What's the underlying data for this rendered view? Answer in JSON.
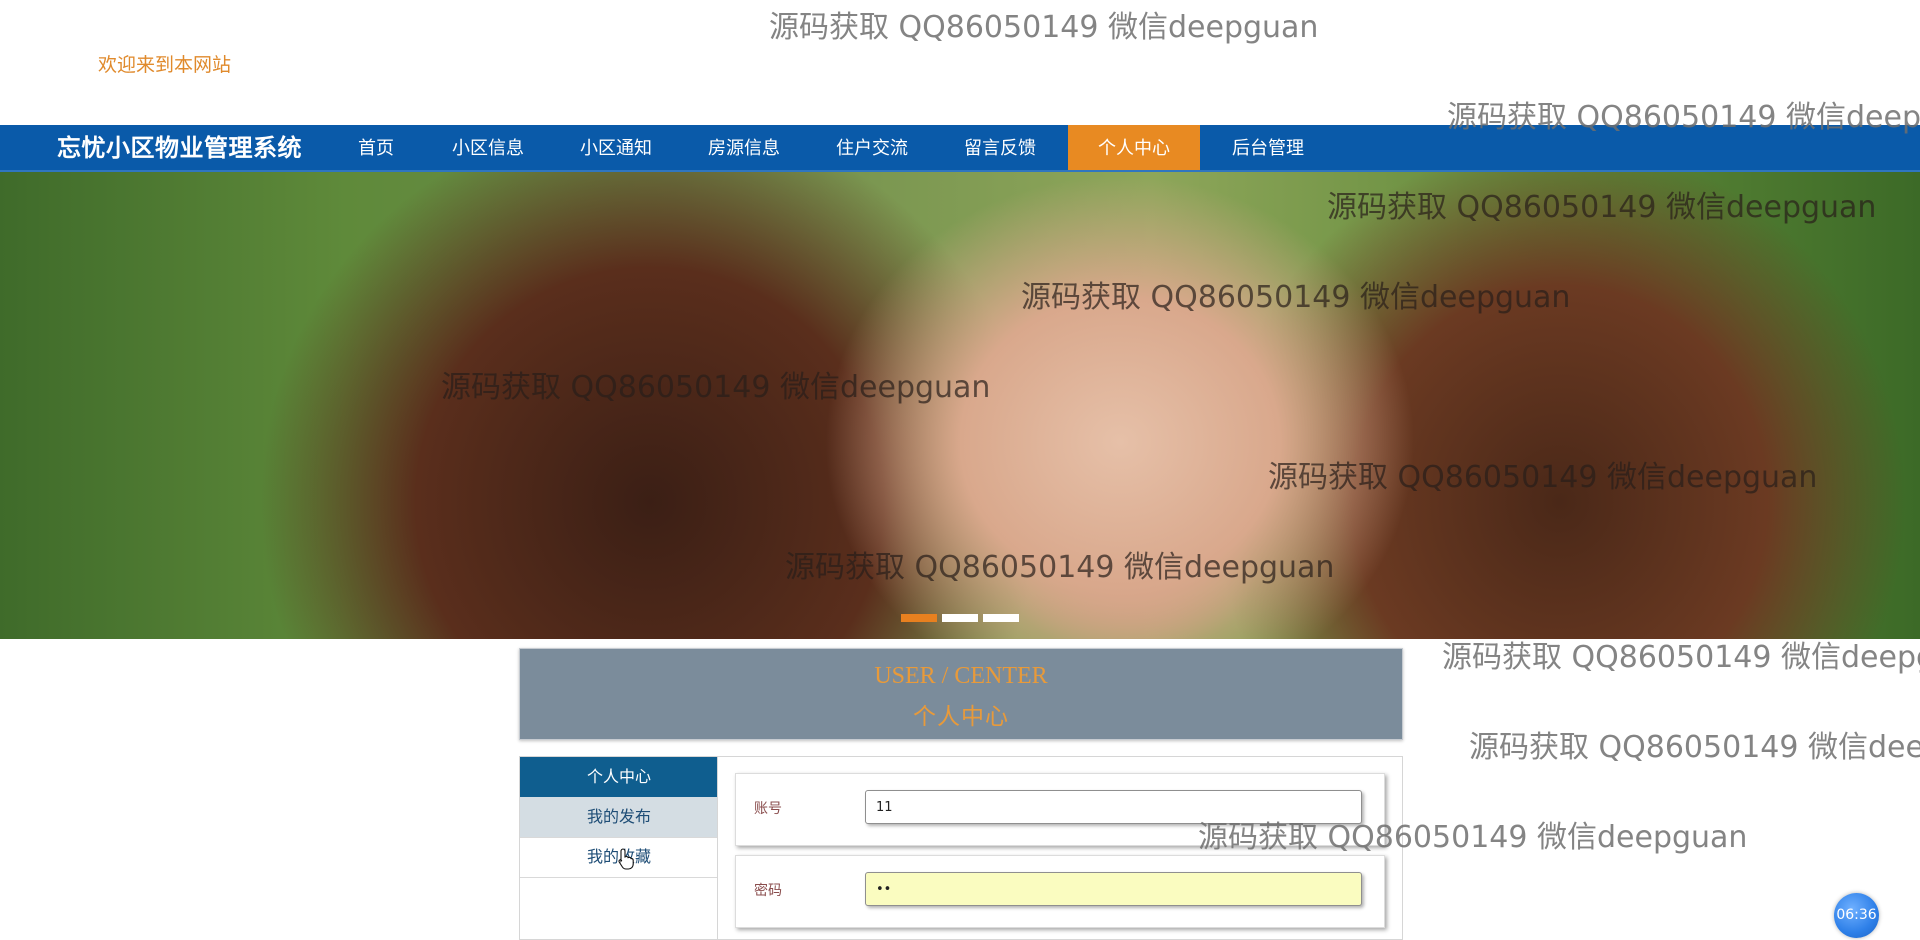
{
  "header": {
    "welcome": "欢迎来到本网站"
  },
  "nav": {
    "brand": "忘忧小区物业管理系统",
    "items": [
      {
        "label": "首页"
      },
      {
        "label": "小区信息"
      },
      {
        "label": "小区通知"
      },
      {
        "label": "房源信息"
      },
      {
        "label": "住户交流"
      },
      {
        "label": "留言反馈"
      },
      {
        "label": "个人中心"
      },
      {
        "label": "后台管理"
      }
    ],
    "active_index": 6,
    "bar_color": "#0a5aa9",
    "active_color": "#e88a22"
  },
  "banner": {
    "slide_count": 3,
    "active_slide": 1
  },
  "section": {
    "title_en": "USER / CENTER",
    "title_cn": "个人中心"
  },
  "sidebar": {
    "items": [
      {
        "label": "个人中心"
      },
      {
        "label": "我的发布"
      },
      {
        "label": "我的收藏"
      }
    ]
  },
  "form": {
    "account": {
      "label": "账号",
      "value": "11"
    },
    "password": {
      "label": "密码",
      "value": "••"
    }
  },
  "timer": "06:36",
  "watermark": {
    "text": "源码获取 QQ86050149 微信deepguan",
    "text_cut_1": "源码获取 QQ86050149 微信deepg",
    "text_cut_2": "源码获取 QQ86050149 微信deepg",
    "text_cut_3": "源码获取 QQ86050149 微信deep"
  }
}
